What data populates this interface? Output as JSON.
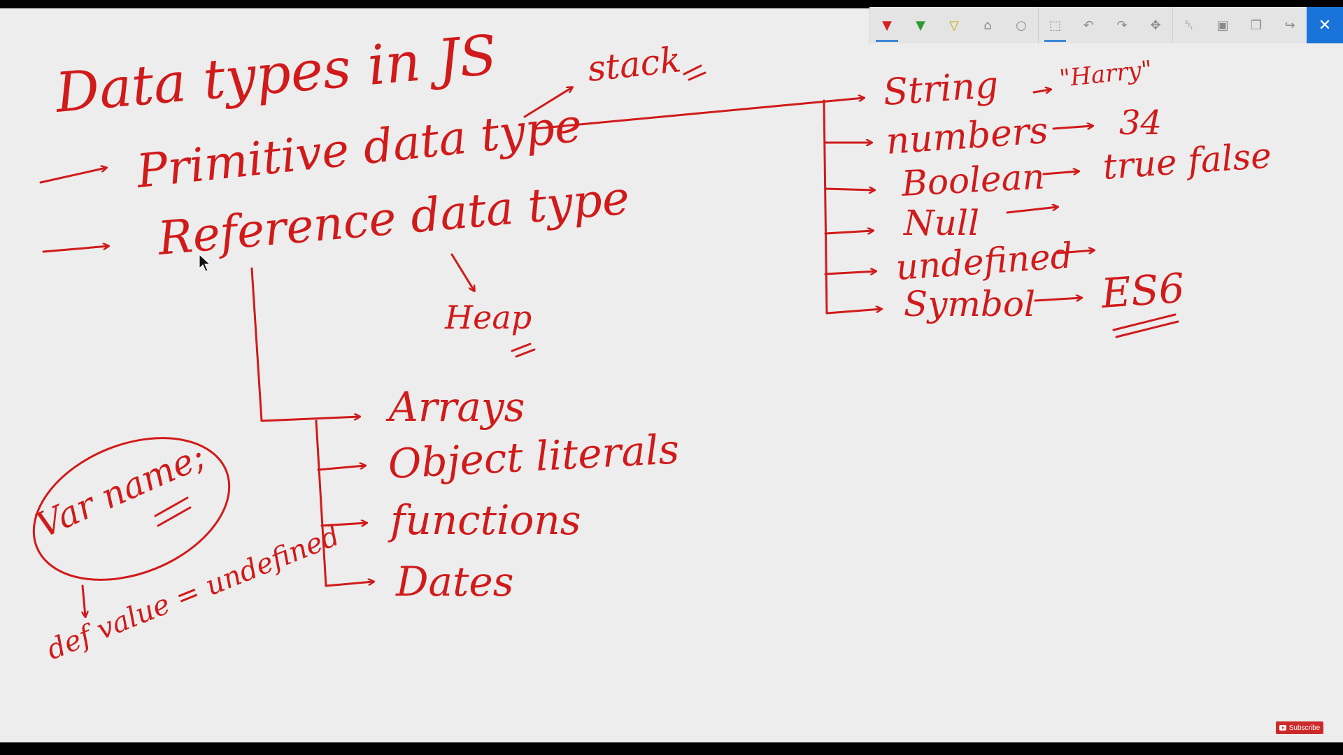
{
  "toolbar": {
    "tools": [
      {
        "name": "pen-red-icon",
        "glyph": "▼",
        "cls": "pen-red",
        "active": true,
        "sep": false
      },
      {
        "name": "pen-green-icon",
        "glyph": "▼",
        "cls": "pen-green",
        "active": false,
        "sep": false
      },
      {
        "name": "highlighter-yellow-icon",
        "glyph": "▽",
        "cls": "pen-yellow",
        "active": false,
        "sep": false
      },
      {
        "name": "eraser-icon",
        "glyph": "⌂",
        "cls": "",
        "active": false,
        "sep": false
      },
      {
        "name": "shape-icon",
        "glyph": "○",
        "cls": "",
        "active": false,
        "sep": false
      },
      {
        "name": "lasso-select-icon",
        "glyph": "⬚",
        "cls": "",
        "active": true,
        "sep": true
      },
      {
        "name": "undo-icon",
        "glyph": "↶",
        "cls": "",
        "active": false,
        "sep": false
      },
      {
        "name": "redo-icon",
        "glyph": "↷",
        "cls": "",
        "active": false,
        "sep": false
      },
      {
        "name": "pan-icon",
        "glyph": "✥",
        "cls": "",
        "active": false,
        "sep": false
      },
      {
        "name": "delete-icon",
        "glyph": "␡",
        "cls": "",
        "active": false,
        "sep": true
      },
      {
        "name": "save-icon",
        "glyph": "▣",
        "cls": "",
        "active": false,
        "sep": false
      },
      {
        "name": "copy-icon",
        "glyph": "❐",
        "cls": "",
        "active": false,
        "sep": false
      },
      {
        "name": "share-icon",
        "glyph": "↪",
        "cls": "",
        "active": false,
        "sep": false
      }
    ],
    "close_glyph": "✕"
  },
  "notes": {
    "title": "Data types in JS",
    "primitive": "Primitive data type",
    "reference": "Reference data type",
    "stack": "stack",
    "heap": "Heap",
    "primitives": [
      {
        "label": "String",
        "value": "\"Harry\""
      },
      {
        "label": "numbers",
        "value": "34"
      },
      {
        "label": "Boolean",
        "value": "true false"
      },
      {
        "label": "Null",
        "value": ""
      },
      {
        "label": "undefined",
        "value": ""
      },
      {
        "label": "Symbol",
        "value": "ES6"
      }
    ],
    "references": [
      "Arrays",
      "Object literals",
      "functions",
      "Dates"
    ],
    "var_decl": "Var name;",
    "default_value": "def value = undefined"
  },
  "overlay": {
    "subscribe": "Subscribe"
  },
  "colors": {
    "ink": "#d11a1a",
    "background": "#ededed",
    "accent": "#1a73d9"
  }
}
